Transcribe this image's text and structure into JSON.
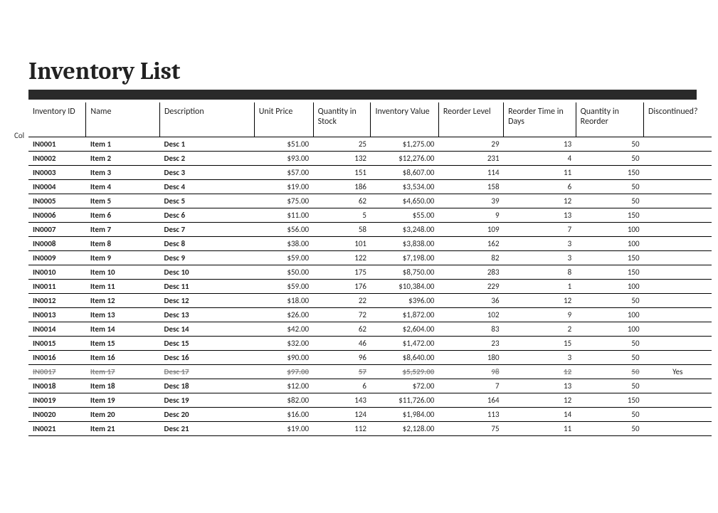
{
  "title": "Inventory List",
  "sidelabel": "Col",
  "headers": {
    "id": "Inventory ID",
    "name": "Name",
    "desc": "Description",
    "price": "Unit Price",
    "qty": "Quantity in Stock",
    "val": "Inventory Value",
    "re": "Reorder Level",
    "rt": "Reorder Time in Days",
    "qr": "Quantity in Reorder",
    "disc": "Discontinued?"
  },
  "rows": [
    {
      "id": "IN0001",
      "name": "Item 1",
      "desc": "Desc 1",
      "price": "$51.00",
      "qty": "25",
      "val": "$1,275.00",
      "re": "29",
      "rt": "13",
      "qr": "50",
      "disc": ""
    },
    {
      "id": "IN0002",
      "name": "Item 2",
      "desc": "Desc 2",
      "price": "$93.00",
      "qty": "132",
      "val": "$12,276.00",
      "re": "231",
      "rt": "4",
      "qr": "50",
      "disc": ""
    },
    {
      "id": "IN0003",
      "name": "Item 3",
      "desc": "Desc 3",
      "price": "$57.00",
      "qty": "151",
      "val": "$8,607.00",
      "re": "114",
      "rt": "11",
      "qr": "150",
      "disc": ""
    },
    {
      "id": "IN0004",
      "name": "Item 4",
      "desc": "Desc 4",
      "price": "$19.00",
      "qty": "186",
      "val": "$3,534.00",
      "re": "158",
      "rt": "6",
      "qr": "50",
      "disc": ""
    },
    {
      "id": "IN0005",
      "name": "Item 5",
      "desc": "Desc 5",
      "price": "$75.00",
      "qty": "62",
      "val": "$4,650.00",
      "re": "39",
      "rt": "12",
      "qr": "50",
      "disc": ""
    },
    {
      "id": "IN0006",
      "name": "Item 6",
      "desc": "Desc 6",
      "price": "$11.00",
      "qty": "5",
      "val": "$55.00",
      "re": "9",
      "rt": "13",
      "qr": "150",
      "disc": ""
    },
    {
      "id": "IN0007",
      "name": "Item 7",
      "desc": "Desc 7",
      "price": "$56.00",
      "qty": "58",
      "val": "$3,248.00",
      "re": "109",
      "rt": "7",
      "qr": "100",
      "disc": ""
    },
    {
      "id": "IN0008",
      "name": "Item 8",
      "desc": "Desc 8",
      "price": "$38.00",
      "qty": "101",
      "val": "$3,838.00",
      "re": "162",
      "rt": "3",
      "qr": "100",
      "disc": ""
    },
    {
      "id": "IN0009",
      "name": "Item 9",
      "desc": "Desc 9",
      "price": "$59.00",
      "qty": "122",
      "val": "$7,198.00",
      "re": "82",
      "rt": "3",
      "qr": "150",
      "disc": ""
    },
    {
      "id": "IN0010",
      "name": "Item 10",
      "desc": "Desc 10",
      "price": "$50.00",
      "qty": "175",
      "val": "$8,750.00",
      "re": "283",
      "rt": "8",
      "qr": "150",
      "disc": ""
    },
    {
      "id": "IN0011",
      "name": "Item 11",
      "desc": "Desc 11",
      "price": "$59.00",
      "qty": "176",
      "val": "$10,384.00",
      "re": "229",
      "rt": "1",
      "qr": "100",
      "disc": ""
    },
    {
      "id": "IN0012",
      "name": "Item 12",
      "desc": "Desc 12",
      "price": "$18.00",
      "qty": "22",
      "val": "$396.00",
      "re": "36",
      "rt": "12",
      "qr": "50",
      "disc": ""
    },
    {
      "id": "IN0013",
      "name": "Item 13",
      "desc": "Desc 13",
      "price": "$26.00",
      "qty": "72",
      "val": "$1,872.00",
      "re": "102",
      "rt": "9",
      "qr": "100",
      "disc": ""
    },
    {
      "id": "IN0014",
      "name": "Item 14",
      "desc": "Desc 14",
      "price": "$42.00",
      "qty": "62",
      "val": "$2,604.00",
      "re": "83",
      "rt": "2",
      "qr": "100",
      "disc": ""
    },
    {
      "id": "IN0015",
      "name": "Item 15",
      "desc": "Desc 15",
      "price": "$32.00",
      "qty": "46",
      "val": "$1,472.00",
      "re": "23",
      "rt": "15",
      "qr": "50",
      "disc": ""
    },
    {
      "id": "IN0016",
      "name": "Item 16",
      "desc": "Desc 16",
      "price": "$90.00",
      "qty": "96",
      "val": "$8,640.00",
      "re": "180",
      "rt": "3",
      "qr": "50",
      "disc": ""
    },
    {
      "id": "IN0017",
      "name": "Item 17",
      "desc": "Desc 17",
      "price": "$97.00",
      "qty": "57",
      "val": "$5,529.00",
      "re": "98",
      "rt": "12",
      "qr": "50",
      "disc": "Yes",
      "discontinued": true
    },
    {
      "id": "IN0018",
      "name": "Item 18",
      "desc": "Desc 18",
      "price": "$12.00",
      "qty": "6",
      "val": "$72.00",
      "re": "7",
      "rt": "13",
      "qr": "50",
      "disc": ""
    },
    {
      "id": "IN0019",
      "name": "Item 19",
      "desc": "Desc 19",
      "price": "$82.00",
      "qty": "143",
      "val": "$11,726.00",
      "re": "164",
      "rt": "12",
      "qr": "150",
      "disc": ""
    },
    {
      "id": "IN0020",
      "name": "Item 20",
      "desc": "Desc 20",
      "price": "$16.00",
      "qty": "124",
      "val": "$1,984.00",
      "re": "113",
      "rt": "14",
      "qr": "50",
      "disc": ""
    },
    {
      "id": "IN0021",
      "name": "Item 21",
      "desc": "Desc 21",
      "price": "$19.00",
      "qty": "112",
      "val": "$2,128.00",
      "re": "75",
      "rt": "11",
      "qr": "50",
      "disc": ""
    }
  ]
}
